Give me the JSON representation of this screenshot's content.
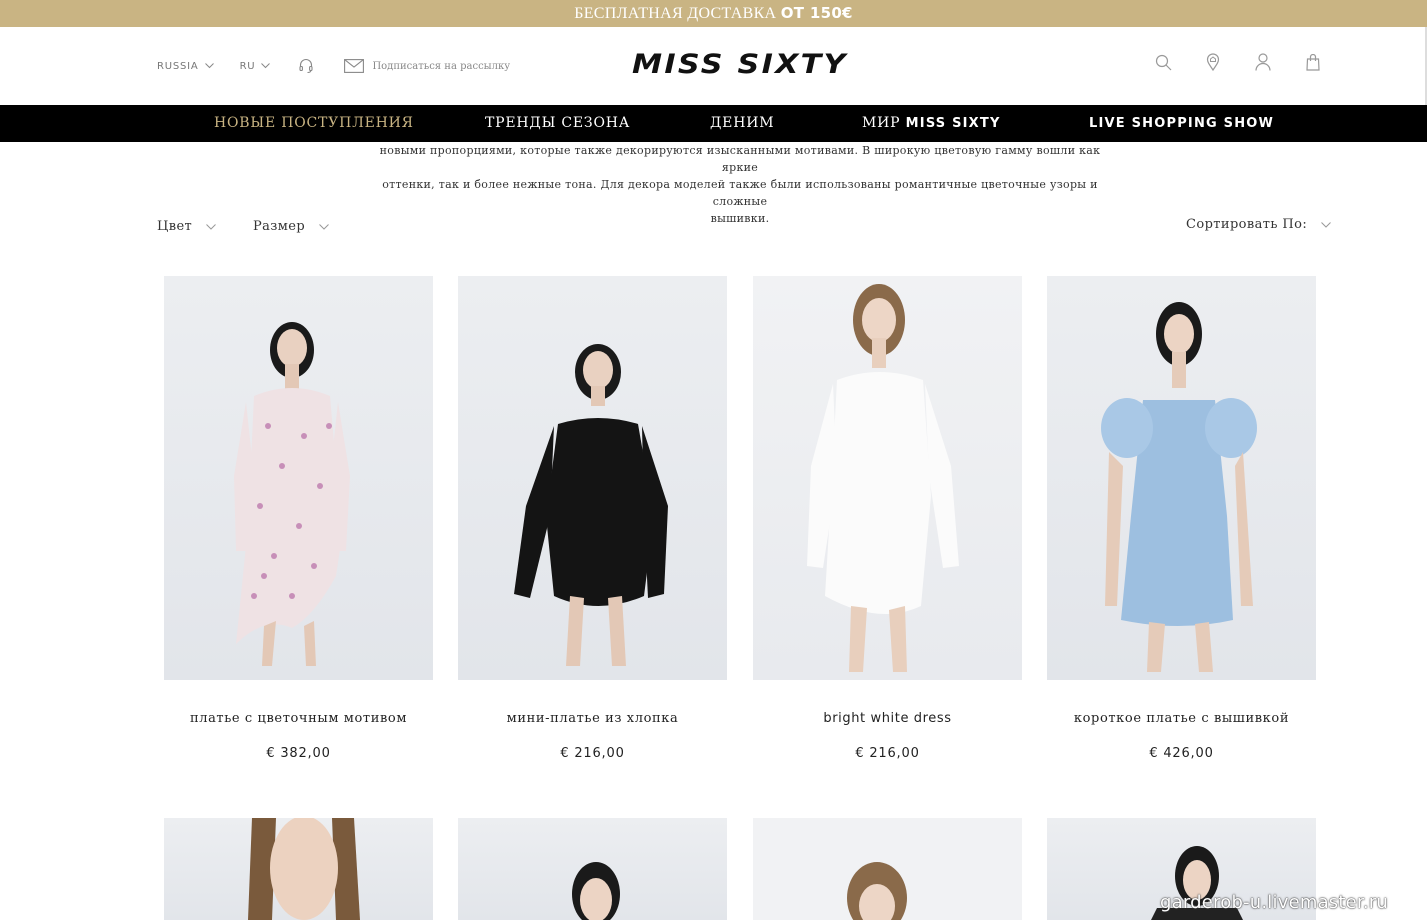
{
  "promo": {
    "text": "БЕСПЛАТНАЯ ДОСТАВКА",
    "highlight": "ОТ 150€"
  },
  "header": {
    "country": "RUSSIA",
    "language": "RU",
    "newsletter": "Подписаться на рассылку",
    "logo": "MISS SIXTY",
    "icons": [
      "search-icon",
      "store-locator-icon",
      "account-icon",
      "bag-icon"
    ]
  },
  "nav": {
    "items": [
      "НОВЫЕ ПОСТУПЛЕНИЯ",
      "ТРЕНДЫ СЕЗОНА",
      "ДЕНИМ",
      "МИР",
      "MISS SIXTY",
      "LIVE SHOPPING SHOW"
    ]
  },
  "intro": {
    "line1": "новыми пропорциями, которые также декорируются изысканными мотивами. В широкую цветовую гамму вошли как яркие",
    "line2": "оттенки, так и более нежные тона. Для декора моделей также были использованы романтичные цветочные узоры и сложные",
    "line3": "вышивки."
  },
  "filters": {
    "color": "Цвет",
    "size": "Размер",
    "sort": "Сортировать По:"
  },
  "products": [
    {
      "name": "платье с цветочным мотивом",
      "price": "€ 382,00"
    },
    {
      "name": "мини-платье из хлопка",
      "price": "€ 216,00"
    },
    {
      "name": "bright white dress",
      "price": "€ 216,00"
    },
    {
      "name": "короткое платье с вышивкой",
      "price": "€ 426,00"
    }
  ],
  "watermark": "garderob-u.livemaster.ru",
  "colors": {
    "promo": "#c9b483",
    "nav_bg": "#000000",
    "nav_active": "#c9b483"
  }
}
